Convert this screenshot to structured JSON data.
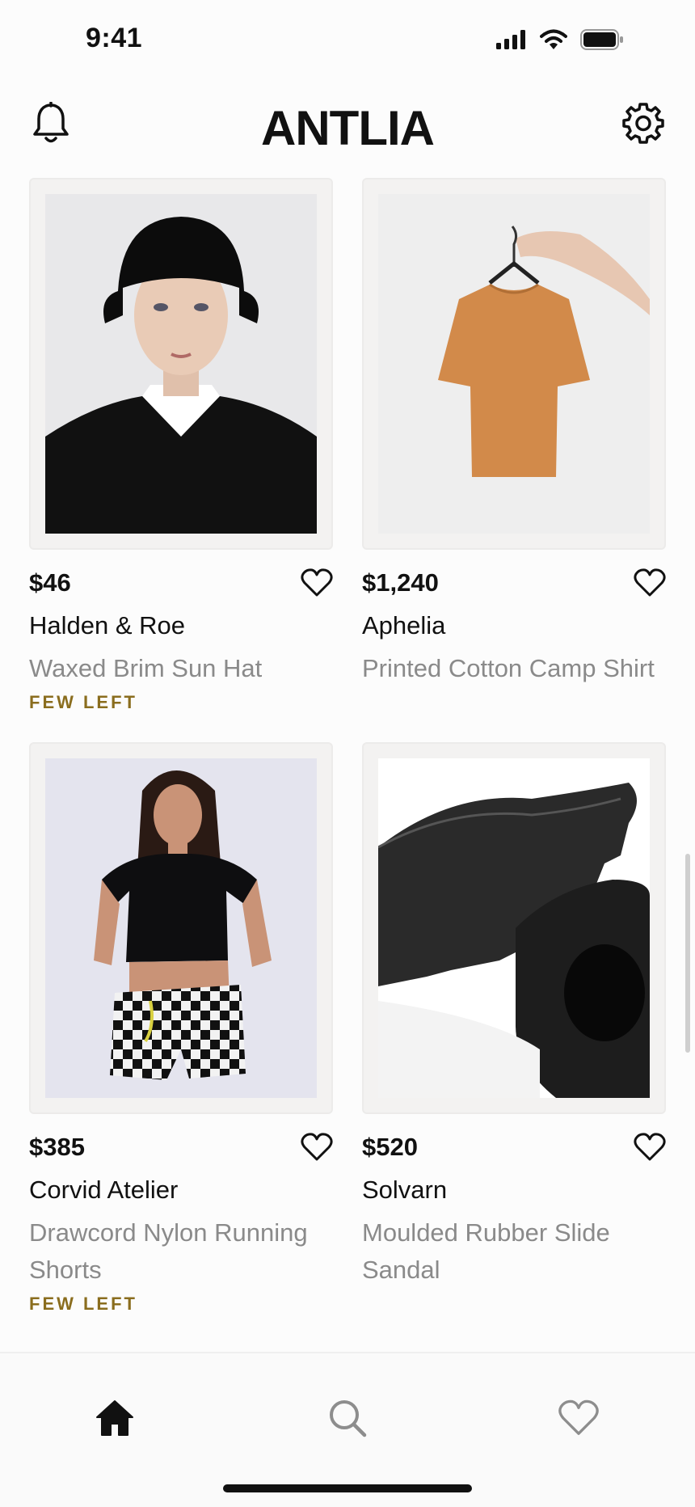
{
  "status": {
    "time": "9:41"
  },
  "header": {
    "title": "ANTLIA"
  },
  "products": [
    {
      "price": "$46",
      "brand": "Halden & Roe",
      "description": "Waxed Brim Sun Hat",
      "badge": "FEW LEFT",
      "image": "person-in-black-bucket-hat"
    },
    {
      "price": "$1,240",
      "brand": "Aphelia",
      "description": "Printed Cotton Camp Shirt",
      "badge": "",
      "image": "orange-tshirt-on-hanger"
    },
    {
      "price": "$385",
      "brand": "Corvid Atelier",
      "description": "Drawcord Nylon Running Shorts",
      "badge": "FEW LEFT",
      "image": "woman-in-checkered-shorts"
    },
    {
      "price": "$520",
      "brand": "Solvarn",
      "description": "Moulded Rubber Slide Sandal",
      "badge": "",
      "image": "black-rubber-slides"
    }
  ],
  "tabs": [
    {
      "name": "home",
      "icon": "home-icon",
      "active": true
    },
    {
      "name": "search",
      "icon": "search-icon",
      "active": false
    },
    {
      "name": "favorites",
      "icon": "heart-icon",
      "active": false
    }
  ],
  "colors": {
    "badge": "#8a6d1e",
    "muted": "#8a8a8a",
    "text": "#111111"
  }
}
